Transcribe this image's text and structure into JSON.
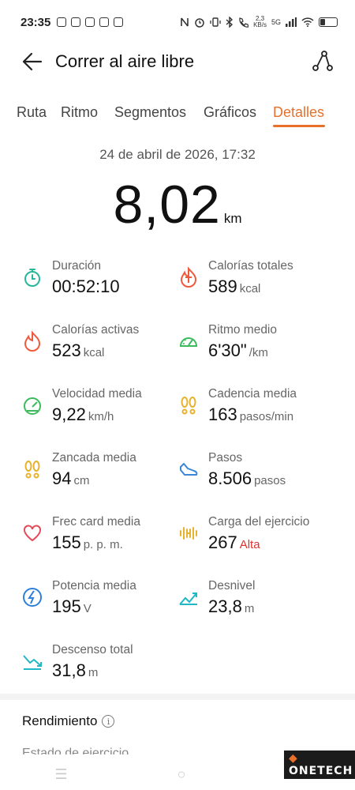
{
  "status_bar": {
    "time": "23:35",
    "speed_top": "2,3",
    "speed_bottom": "KB/s",
    "network": "5G"
  },
  "header": {
    "title": "Correr al aire libre"
  },
  "tabs": [
    {
      "label": "Ruta"
    },
    {
      "label": "Ritmo"
    },
    {
      "label": "Segmentos"
    },
    {
      "label": "Gráficos"
    },
    {
      "label": "Detalles",
      "active": true
    }
  ],
  "summary": {
    "date": "24 de abril de 2026, 17:32",
    "distance": "8,02",
    "distance_unit": "km"
  },
  "metrics": [
    {
      "label": "Duración",
      "value": "00:52:10",
      "unit": "",
      "icon": "stopwatch-icon",
      "color": "#27b89a"
    },
    {
      "label": "Calorías totales",
      "value": "589",
      "unit": "kcal",
      "icon": "calories-total-icon",
      "color": "#ef5a3c"
    },
    {
      "label": "Calorías activas",
      "value": "523",
      "unit": "kcal",
      "icon": "flame-icon",
      "color": "#ef5a3c"
    },
    {
      "label": "Ritmo medio",
      "value": "6'30\"",
      "unit": "/km",
      "icon": "pace-gauge-icon",
      "color": "#3dbb5c"
    },
    {
      "label": "Velocidad media",
      "value": "9,22",
      "unit": "km/h",
      "icon": "speed-gauge-icon",
      "color": "#3dbb5c"
    },
    {
      "label": "Cadencia media",
      "value": "163",
      "unit": "pasos/min",
      "icon": "footprints-icon",
      "color": "#e8b22c"
    },
    {
      "label": "Zancada media",
      "value": "94",
      "unit": "cm",
      "icon": "stride-icon",
      "color": "#e8b22c"
    },
    {
      "label": "Pasos",
      "value": "8.506",
      "unit": "pasos",
      "icon": "shoe-icon",
      "color": "#3a86d9"
    },
    {
      "label": "Frec card media",
      "value": "155",
      "unit": "p. p. m.",
      "icon": "heart-icon",
      "color": "#e34b5a"
    },
    {
      "label": "Carga del ejercicio",
      "value": "267",
      "unit": "Alta",
      "unit_alert": true,
      "icon": "dumbbell-icon",
      "color": "#e8b22c"
    },
    {
      "label": "Potencia media",
      "value": "195",
      "unit": "V",
      "icon": "power-icon",
      "color": "#2f7fd8"
    },
    {
      "label": "Desnivel",
      "value": "23,8",
      "unit": "m",
      "icon": "ascent-icon",
      "color": "#1fb8c4"
    },
    {
      "label": "Descenso total",
      "value": "31,8",
      "unit": "m",
      "icon": "descent-icon",
      "color": "#1fb8c4"
    }
  ],
  "performance": {
    "title": "Rendimiento",
    "cut_text": "Estado de ejercicio"
  },
  "watermark": {
    "prefix": "◆",
    "text": "ONETECH"
  },
  "colors": {
    "accent": "#e8702a",
    "alert": "#e0302c"
  }
}
